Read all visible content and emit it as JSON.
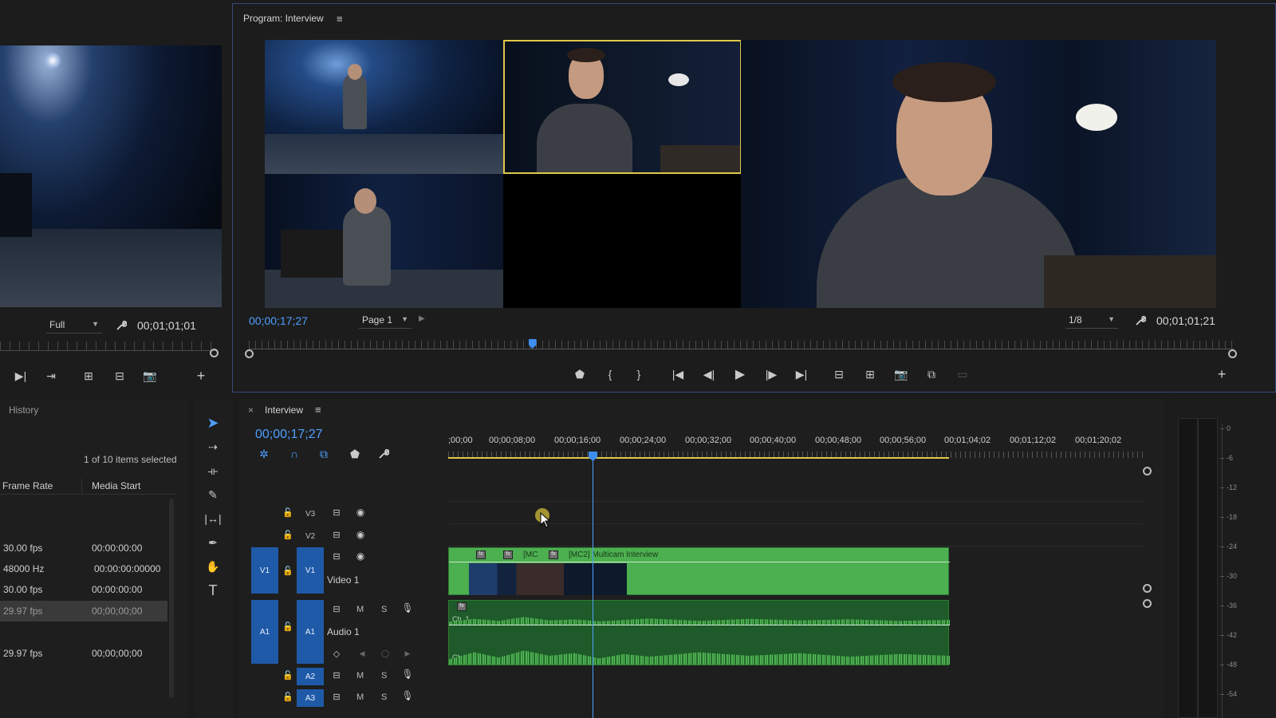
{
  "source_monitor": {
    "zoom": "Full",
    "timecode": "00;01;01;01"
  },
  "program_monitor": {
    "title": "Program: Interview",
    "playhead_timecode": "00;00;17;27",
    "page_select": "Page 1",
    "resolution": "1/8",
    "duration_timecode": "00;01;01;21",
    "playhead_position": 0.288
  },
  "history_panel": {
    "title": "History",
    "selection_status": "1 of 10 items selected",
    "columns": [
      "Frame Rate",
      "Media Start"
    ],
    "rows": [
      {
        "frame_rate": "30.00 fps",
        "media_start": "00:00:00:00"
      },
      {
        "frame_rate": "48000 Hz",
        "media_start": "00:00:00:00000"
      },
      {
        "frame_rate": "30.00 fps",
        "media_start": "00:00:00:00"
      },
      {
        "frame_rate": "29.97 fps",
        "media_start": "00;00;00;00"
      },
      {
        "frame_rate": "29.97 fps",
        "media_start": "00;00;00;00"
      }
    ]
  },
  "timeline": {
    "tab_title": "Interview",
    "timecode": "00;00;17;27",
    "ruler_labels": [
      ";00;00",
      "00;00;08;00",
      "00;00;16;00",
      "00;00;24;00",
      "00;00;32;00",
      "00;00;40;00",
      "00;00;48;00",
      "00;00;56;00",
      "00;01;04;02",
      "00;01;12;02",
      "00;01;20;02"
    ],
    "tracks": {
      "v3": "V3",
      "v2": "V2",
      "v1": "V1",
      "v1_src": "V1",
      "video1_name": "Video 1",
      "a1": "A1",
      "a1_src": "A1",
      "audio1_name": "Audio 1",
      "a2": "A2",
      "a3": "A3",
      "mute": "M",
      "solo": "S"
    },
    "clips": {
      "video_clip_label": "[MC2] Multicam Interview",
      "video_clip_short": "[MC",
      "audio_ch1": "Ch. 1",
      "audio_ch2": "Ch. 2"
    }
  },
  "meter": {
    "scale": [
      "0",
      "-6",
      "-12",
      "-18",
      "-24",
      "-30",
      "-36",
      "-42",
      "-48",
      "-54"
    ]
  },
  "colors": {
    "accent_blue": "#4d9fff",
    "clip_green": "#4caf50",
    "track_blue": "#1f5aa8",
    "selection_yellow": "#e0c84a"
  }
}
